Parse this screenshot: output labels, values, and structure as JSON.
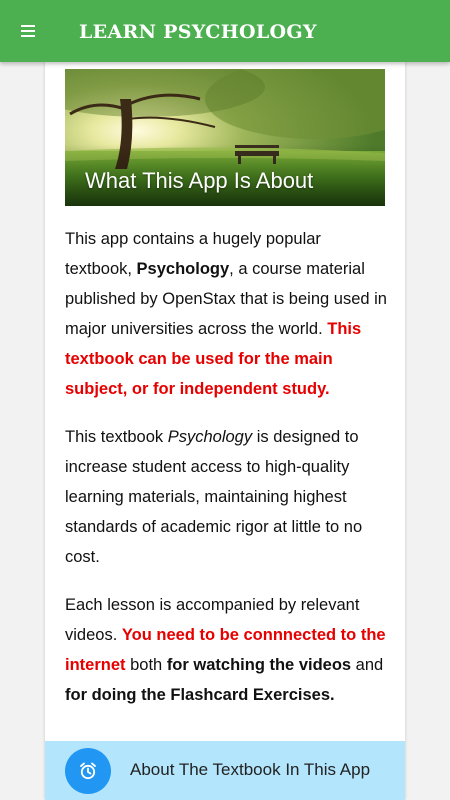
{
  "app_bar": {
    "title": "LEARN PSYCHOLOGY",
    "menu_icon": "hamburger-menu-icon",
    "color": "#4caf50"
  },
  "hero": {
    "caption": "What This App Is About",
    "image": "park-tree-sunrise-bench"
  },
  "content": {
    "p1_a": "This app contains a hugely popular textbook, ",
    "p1_b": "Psychology",
    "p1_c": ", a course material published by OpenStax that is being used in major universities across the world. ",
    "p1_d": "This textbook can be used for the main subject, or for independent study.",
    "p2_a": "This textbook ",
    "p2_b": "Psychology",
    "p2_c": " is designed to increase student access to high-quality learning materials, maintaining highest standards of academic rigor at little to no cost.",
    "p3_a": "Each lesson is accompanied by relevant videos. ",
    "p3_b": "You need to be connnected to the internet",
    "p3_c": " both ",
    "p3_d": "for watching the videos",
    "p3_e": " and ",
    "p3_f": "for doing the Flashcard Exercises."
  },
  "footer": {
    "label": "About The Textbook In This App",
    "icon": "alarm-clock-icon",
    "background": "#b3e5fc",
    "icon_background": "#2196f3"
  },
  "colors": {
    "emphasis_red": "#e60000"
  }
}
